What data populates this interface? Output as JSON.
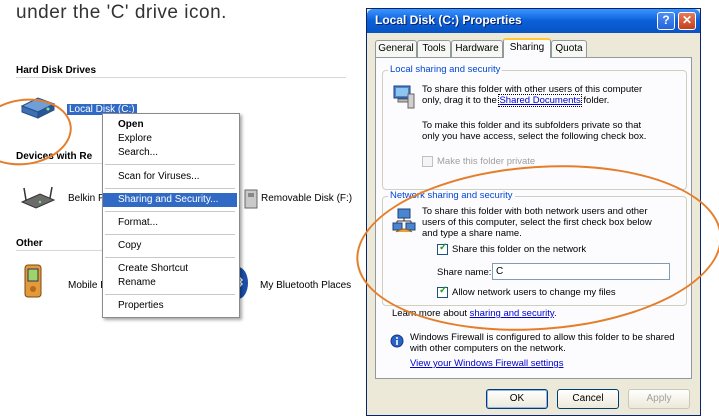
{
  "caption": "under the 'C' drive icon.",
  "explorer": {
    "groups": {
      "hard_disk_drives": "Hard Disk Drives",
      "devices_with_removable": "Devices with Re",
      "other": "Other"
    },
    "items": {
      "local_disk": "Local Disk (C:)",
      "belkin": "Belkin F",
      "removable_disk": "Removable Disk (F:)",
      "mobile": "Mobile D",
      "bluetooth": "My Bluetooth Places"
    }
  },
  "context_menu": {
    "open": "Open",
    "explore": "Explore",
    "search": "Search...",
    "scan": "Scan for Viruses...",
    "sharing": "Sharing and Security...",
    "format": "Format...",
    "copy": "Copy",
    "create_shortcut": "Create Shortcut",
    "rename": "Rename",
    "properties": "Properties"
  },
  "dialog": {
    "title": "Local Disk (C:) Properties",
    "help_glyph": "?",
    "close_glyph": "✕",
    "tabs": [
      "General",
      "Tools",
      "Hardware",
      "Sharing",
      "Quota"
    ],
    "active_tab": "Sharing",
    "local": {
      "frame_title": "Local sharing and security",
      "para1_a": "To share this folder with other users of this computer",
      "para1_b": "only, drag it to the",
      "para1_link": "Shared Documents",
      "para1_c": "folder.",
      "para2_a": "To make this folder and its subfolders private so that",
      "para2_b": "only you have access, select the following check box.",
      "private_label": "Make this folder private",
      "private_checked": false
    },
    "network": {
      "frame_title": "Network sharing and security",
      "para_a": "To share this folder with both network users and other",
      "para_b": "users of this computer, select the first check box below",
      "para_c": "and type a share name.",
      "share_label": "Share this folder on the network",
      "share_checked": true,
      "share_name_label": "Share name:",
      "share_name_value": "C",
      "allow_label": "Allow network users to change my files",
      "allow_checked": true,
      "learn_prefix": "Learn more about",
      "learn_link": "sharing and security",
      "learn_suffix": "."
    },
    "firewall": {
      "line1": "Windows Firewall is configured to allow this folder to be shared",
      "line2": "with other computers on the network.",
      "link": "View your Windows Firewall settings"
    },
    "buttons": {
      "ok": "OK",
      "cancel": "Cancel",
      "apply": "Apply"
    }
  },
  "colors": {
    "annotation": "#e57e2b",
    "xp_blue": "#0a5fd8",
    "highlight": "#316ac5"
  }
}
